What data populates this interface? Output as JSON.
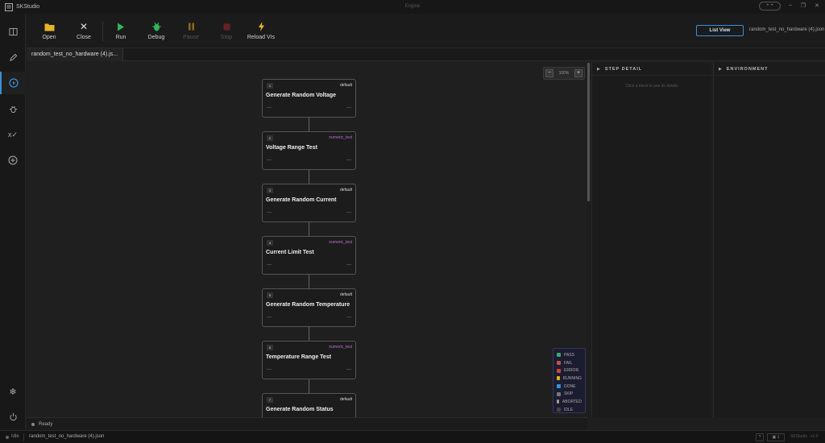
{
  "titlebar": {
    "app_name": "SKStudio",
    "center_text": "Engine",
    "pill": "+ +"
  },
  "toolbar": {
    "open_label": "Open",
    "close_label": "Close",
    "run_label": "Run",
    "debug_label": "Debug",
    "pause_label": "Pause",
    "stop_label": "Stop",
    "reload_label": "Reload VIs",
    "list_view_label": "List View",
    "file_name": "random_test_no_hardware (4).json"
  },
  "tabs": [
    {
      "label": "random_test_no_hardware (4).js..."
    }
  ],
  "zoom": {
    "minus": "−",
    "value": "100%",
    "plus": "+"
  },
  "nodes": [
    {
      "index": "1",
      "type": "default",
      "title": "Generate Random Voltage"
    },
    {
      "index": "2",
      "type": "numeric_test",
      "title": "Voltage Range Test"
    },
    {
      "index": "3",
      "type": "default",
      "title": "Generate Random Current"
    },
    {
      "index": "4",
      "type": "numeric_test",
      "title": "Current Limit Test"
    },
    {
      "index": "5",
      "type": "default",
      "title": "Generate Random Temperature"
    },
    {
      "index": "6",
      "type": "numeric_test",
      "title": "Temperature Range Test"
    },
    {
      "index": "7",
      "type": "default",
      "title": "Generate Random Status"
    }
  ],
  "legend": [
    {
      "label": "PASS",
      "color": "#3aa86b"
    },
    {
      "label": "FAIL",
      "color": "#c0504d"
    },
    {
      "label": "ERROR",
      "color": "#d04040"
    },
    {
      "label": "RUNNING",
      "color": "#e0b020"
    },
    {
      "label": "DONE",
      "color": "#3a8fd8"
    },
    {
      "label": "SKIP",
      "color": "#777777"
    },
    {
      "label": "ABORTED",
      "color": "#9a9a9a"
    },
    {
      "label": "IDLE",
      "color": "#444444"
    }
  ],
  "status": {
    "ready": "Ready"
  },
  "step_detail": {
    "title": "STEP DETAIL",
    "hint": "Click a block to see its details"
  },
  "environment": {
    "title": "ENVIRONMENT"
  },
  "footer": {
    "state": "Idle",
    "file": "random_test_no_hardware (4).json",
    "box1": "?",
    "box2": "▣ 1",
    "version_name": "SKStudio",
    "version": "v1.0"
  },
  "colors": {
    "accent": "#3a8fd8",
    "numeric_type": "#c070d0",
    "run_green": "#2fb45a",
    "open_folder": "#e8b32a"
  }
}
